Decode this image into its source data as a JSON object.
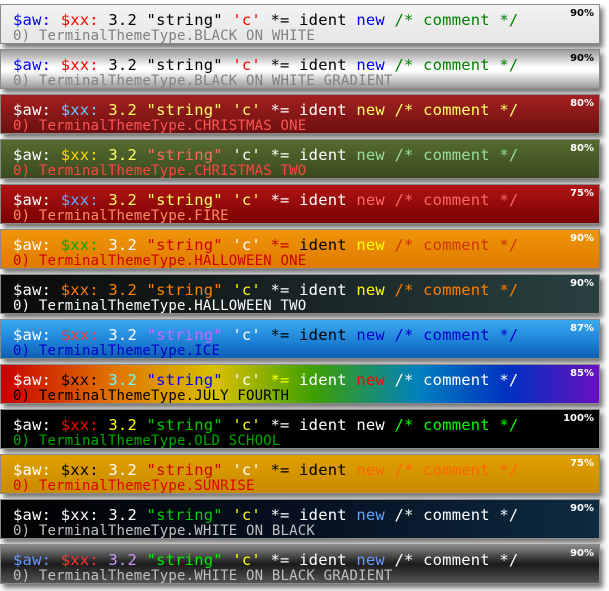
{
  "sample_tokens": {
    "var": "$aw:",
    "var2": "$xx:",
    "number": "3.2",
    "string": "\"string\"",
    "char": "'c'",
    "operator": "*=",
    "ident": "ident",
    "keyword": "new",
    "comment": "/* comment */"
  },
  "themes": [
    {
      "label": "0) TerminalThemeType.BLACK_ON_WHITE",
      "opacity": "90%",
      "colors": {
        "var": "#0000ff",
        "var2": "#ff0000",
        "number": "#000000",
        "string": "#000000",
        "char": "#ff0000",
        "operator": "#000000",
        "ident": "#000000",
        "keyword": "#0000ff",
        "comment": "#008000",
        "label": "#808080",
        "pct": "#000000"
      }
    },
    {
      "label": "0) TerminalThemeType.BLACK_ON_WHITE_GRADIENT",
      "opacity": "90%",
      "colors": {
        "var": "#0000ff",
        "var2": "#ff0000",
        "number": "#000000",
        "string": "#000000",
        "char": "#ff0000",
        "operator": "#000000",
        "ident": "#000000",
        "keyword": "#0000ff",
        "comment": "#008000",
        "label": "#808080",
        "pct": "#000000"
      }
    },
    {
      "label": "0) TerminalThemeType.CHRISTMAS_ONE",
      "opacity": "80%",
      "colors": {
        "var": "#ffffff",
        "var2": "#66ccff",
        "number": "#ffff66",
        "string": "#ffff66",
        "char": "#ffff66",
        "operator": "#ffffff",
        "ident": "#ffffff",
        "keyword": "#ffff66",
        "comment": "#ffff66",
        "label": "#ff5555",
        "pct": "#ffffff"
      }
    },
    {
      "label": "0) TerminalThemeType.CHRISTMAS_TWO",
      "opacity": "80%",
      "colors": {
        "var": "#ffffff",
        "var2": "#ffd700",
        "number": "#ffff66",
        "string": "#ff6666",
        "char": "#ffffff",
        "operator": "#ffffff",
        "ident": "#ffffff",
        "keyword": "#99dd99",
        "comment": "#99dd99",
        "label": "#ff4444",
        "pct": "#ffffff"
      }
    },
    {
      "label": "0) TerminalThemeType.FIRE",
      "opacity": "75%",
      "colors": {
        "var": "#ffffff",
        "var2": "#66aaff",
        "number": "#ffff66",
        "string": "#ffff66",
        "char": "#ffff66",
        "operator": "#ffffff",
        "ident": "#ffffff",
        "keyword": "#ff6666",
        "comment": "#ff6666",
        "label": "#ff8c66",
        "pct": "#ffffff"
      }
    },
    {
      "label": "0) TerminalThemeType.HALLOWEEN_ONE",
      "opacity": "90%",
      "colors": {
        "var": "#ffffff",
        "var2": "#00aa00",
        "number": "#ffffff",
        "string": "#cc0000",
        "char": "#ffffff",
        "operator": "#cc0000",
        "ident": "#000000",
        "keyword": "#ffff00",
        "comment": "#cc3300",
        "label": "#cc0000",
        "pct": "#ffffff"
      }
    },
    {
      "label": "0) TerminalThemeType.HALLOWEEN_TWO",
      "opacity": "90%",
      "colors": {
        "var": "#ffffff",
        "var2": "#ff7f00",
        "number": "#ff7f00",
        "string": "#ff7f00",
        "char": "#ffff00",
        "operator": "#ffffff",
        "ident": "#ffffff",
        "keyword": "#ffff00",
        "comment": "#ff7f00",
        "label": "#ffffff",
        "pct": "#ffffff"
      }
    },
    {
      "label": "0) TerminalThemeType.ICE",
      "opacity": "87%",
      "colors": {
        "var": "#ffffff",
        "var2": "#ff3333",
        "number": "#ffffff",
        "string": "#cc66ff",
        "char": "#ffffff",
        "operator": "#000000",
        "ident": "#000000",
        "keyword": "#0000cc",
        "comment": "#0000cc",
        "label": "#0000cc",
        "pct": "#ffffff"
      }
    },
    {
      "label": "0) TerminalThemeType.JULY_FOURTH",
      "opacity": "85%",
      "colors": {
        "var": "#ffffff",
        "var2": "#000000",
        "number": "#66ffff",
        "string": "#0000ff",
        "char": "#ffffff",
        "operator": "#ffff00",
        "ident": "#ffffff",
        "keyword": "#ff0000",
        "comment": "#ffffff",
        "label": "#000000",
        "pct": "#ffffff"
      }
    },
    {
      "label": "0) TerminalThemeType.OLD_SCHOOL",
      "opacity": "100%",
      "colors": {
        "var": "#ffffff",
        "var2": "#ff0000",
        "number": "#ffff00",
        "string": "#00cc00",
        "char": "#ffff00",
        "operator": "#ffffff",
        "ident": "#ffffff",
        "keyword": "#ffffff",
        "comment": "#00ff00",
        "label": "#00aa00",
        "pct": "#ffffff"
      }
    },
    {
      "label": "0) TerminalThemeType.SUNRISE",
      "opacity": "75%",
      "colors": {
        "var": "#ffffff",
        "var2": "#000000",
        "number": "#ffffff",
        "string": "#cc0000",
        "char": "#ffffff",
        "operator": "#000000",
        "ident": "#000000",
        "keyword": "#ff6600",
        "comment": "#ff6600",
        "label": "#dd0000",
        "pct": "#ffffff"
      }
    },
    {
      "label": "0) TerminalThemeType.WHITE_ON_BLACK",
      "opacity": "90%",
      "colors": {
        "var": "#ffffff",
        "var2": "#ffffff",
        "number": "#ffffff",
        "string": "#00cc00",
        "char": "#ffff00",
        "operator": "#ffffff",
        "ident": "#ffffff",
        "keyword": "#66a3ff",
        "comment": "#ffffff",
        "label": "#c0c0c0",
        "pct": "#ffffff"
      }
    },
    {
      "label": "0) TerminalThemeType.WHITE_ON_BLACK_GRADIENT",
      "opacity": "90%",
      "colors": {
        "var": "#6699ff",
        "var2": "#ff3333",
        "number": "#cc99ff",
        "string": "#00ee00",
        "char": "#ffff00",
        "operator": "#ffffff",
        "ident": "#ffffff",
        "keyword": "#6699ff",
        "comment": "#ffffff",
        "label": "#c0c0c0",
        "pct": "#ffffff"
      }
    }
  ]
}
